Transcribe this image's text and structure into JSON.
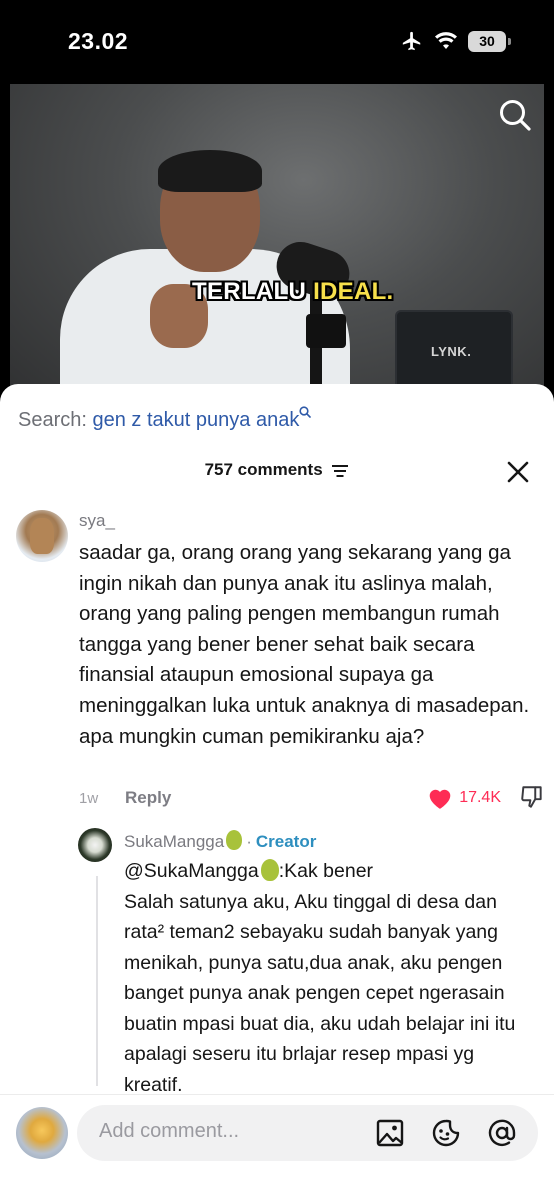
{
  "status": {
    "time": "23.02",
    "battery": "30"
  },
  "video": {
    "caption_plain": "TERLALU ",
    "caption_highlight": "IDEAL.",
    "laptop_brand": "LYNK."
  },
  "search": {
    "prefix": "Search:",
    "term": "gen z takut punya anak"
  },
  "comments_header": {
    "count": "757 comments"
  },
  "comment": {
    "username": "sya_",
    "text": "saadar ga, orang orang yang sekarang yang ga ingin nikah dan punya anak itu aslinya malah, orang yang paling pengen membangun rumah tangga yang bener bener sehat baik secara finansial ataupun emosional supaya ga meninggalkan luka untuk anaknya di masadepan. apa mungkin cuman pemikiranku aja?",
    "time": "1w",
    "reply_label": "Reply",
    "likes": "17.4K"
  },
  "reply": {
    "username": "SukaMangga",
    "creator_label": "Creator",
    "mention": "@SukaMangga",
    "mention_suffix": ":Kak bener",
    "text": "Salah satunya aku, Aku tinggal di desa dan rata² teman2 sebayaku sudah banyak yang menikah, punya satu,dua anak, aku pengen banget punya anak pengen cepet ngerasain buatin mpasi buat dia, aku udah belajar ini itu apalagi seseru itu brlajar resep mpasi yg kreatif."
  },
  "composer": {
    "placeholder": "Add comment..."
  },
  "colors": {
    "like": "#fe2c55",
    "search_term": "#2f5aa8",
    "creator": "#2e8fbf"
  }
}
